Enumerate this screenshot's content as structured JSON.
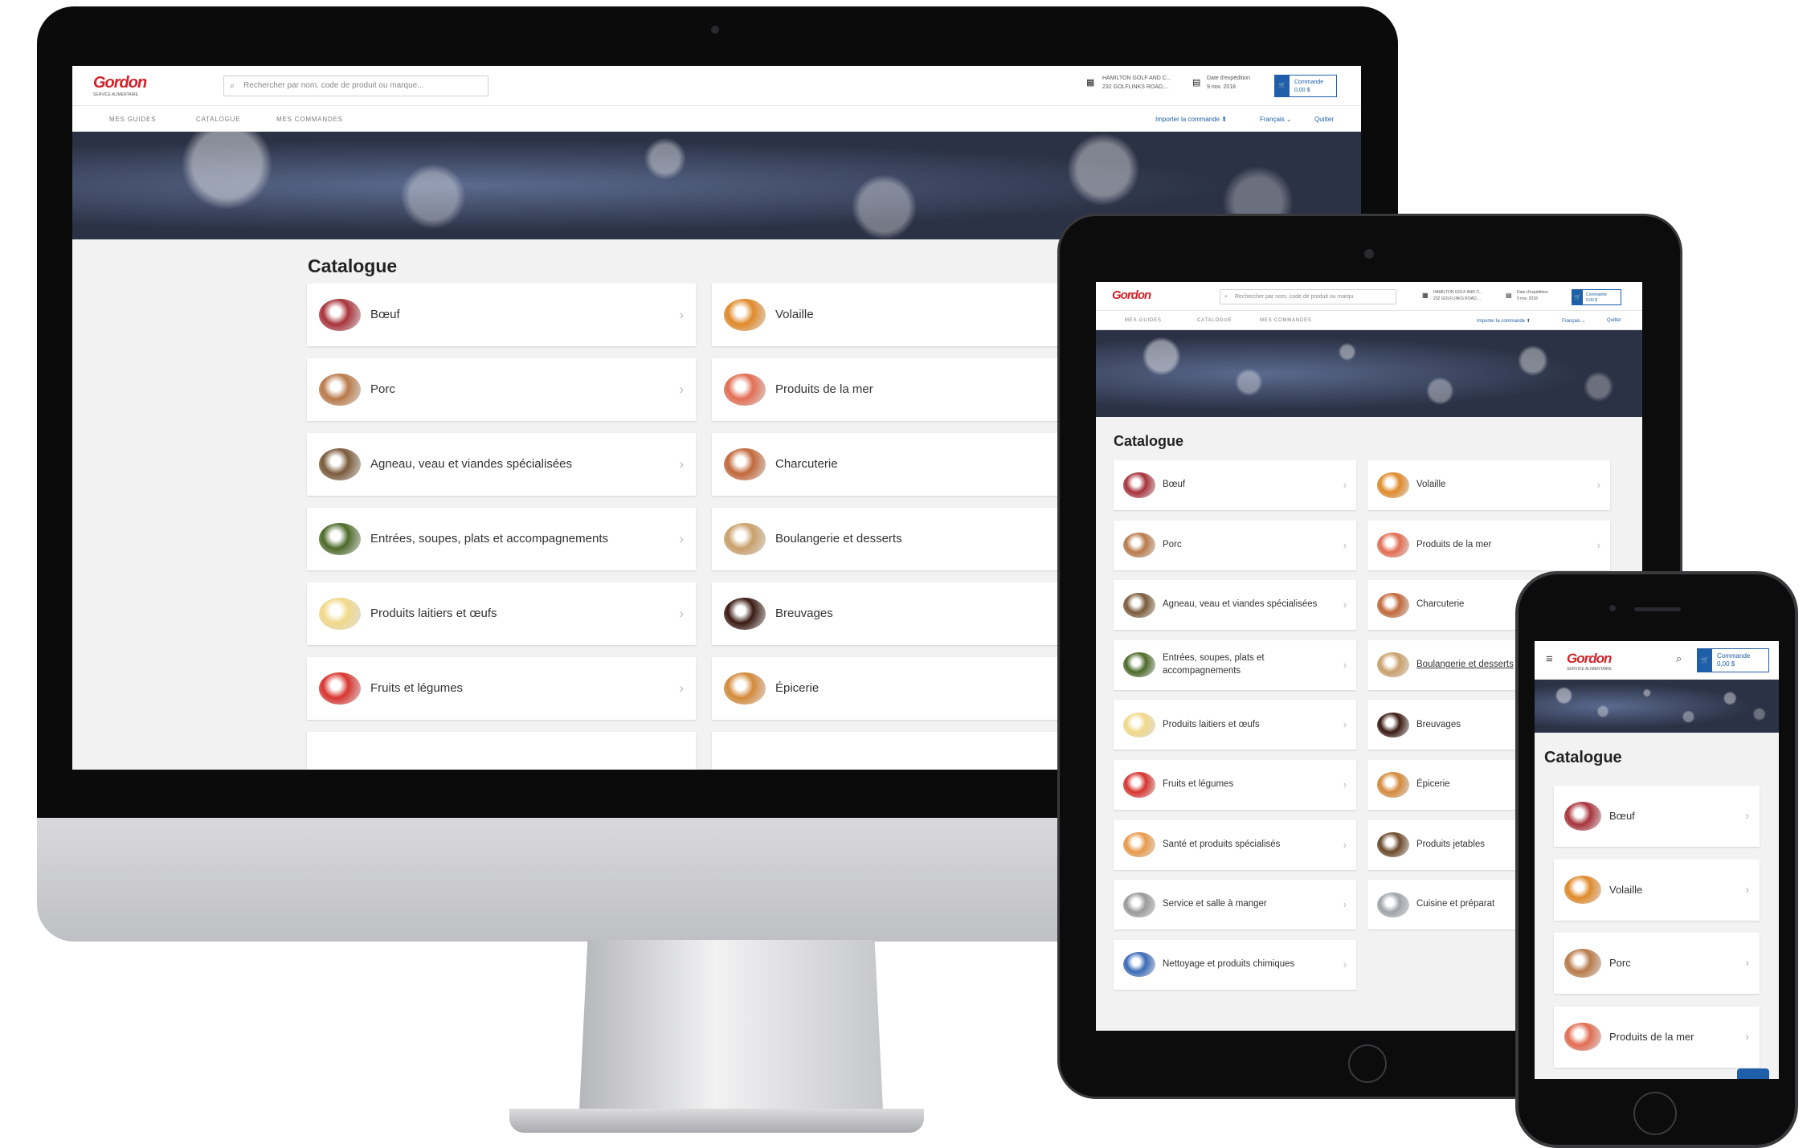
{
  "brand": {
    "name": "Gordon",
    "subtitle": "SERVICE ALIMENTAIRE",
    "color": "#d2232a",
    "accent": "#1f5ea8"
  },
  "header": {
    "search_placeholder": "Rechercher par nom, code de produit ou marque...",
    "tablet_search_placeholder": "Rechercher par nom, code de produit ou marqu",
    "location_line1": "HAMILTON GOLF AND C...",
    "location_line2": "232 GOLFLINKS ROAD,...",
    "date_label": "Date d'expédition",
    "date_value": "9 nov. 2018",
    "cart_label": "Commande",
    "cart_amount": "0,00 $",
    "cart_icon": "cart-icon",
    "location_icon": "store-icon",
    "calendar_icon": "calendar-icon"
  },
  "nav": {
    "items": [
      "MES GUIDES",
      "CATALOGUE",
      "MES COMMANDES"
    ],
    "import": "Importer la commande",
    "language": "Français",
    "quit": "Quitter"
  },
  "catalogue": {
    "title": "Catalogue",
    "desktop_left": [
      "Bœuf",
      "Porc",
      "Agneau, veau et viandes spécialisées",
      "Entrées, soupes, plats et accompagnements",
      "Produits laitiers et œufs",
      "Fruits et légumes"
    ],
    "desktop_right": [
      "Volaille",
      "Produits de la mer",
      "Charcuterie",
      "Boulangerie et desserts",
      "Breuvages",
      "Épicerie"
    ],
    "tablet_left": [
      "Bœuf",
      "Porc",
      "Agneau, veau et viandes spécialisées",
      "Entrées, soupes, plats et accompagnements",
      "Produits laitiers et œufs",
      "Fruits et légumes",
      "Santé et produits spécialisés",
      "Service et salle à manger",
      "Nettoyage et produits chimiques"
    ],
    "tablet_right": [
      "Volaille",
      "Produits de la mer",
      "Charcuterie",
      "Boulangerie et desserts",
      "Breuvages",
      "Épicerie",
      "Produits jetables",
      "Cuisine et préparat"
    ],
    "phone": [
      "Bœuf",
      "Volaille",
      "Porc",
      "Produits de la mer"
    ]
  },
  "icons": {
    "item_colors": {
      "Bœuf": "#a8333c",
      "Porc": "#b97a4a",
      "Agneau, veau et viandes spécialisées": "#7a5a3a",
      "Entrées, soupes, plats et accompagnements": "#4d6b2a",
      "Produits laitiers et œufs": "#f1d98a",
      "Fruits et légumes": "#d8352f",
      "Volaille": "#e08a2a",
      "Produits de la mer": "#e26d52",
      "Charcuterie": "#c2683a",
      "Boulangerie et desserts": "#c9a06a",
      "Breuvages": "#3a1a12",
      "Épicerie": "#d48a3a",
      "Santé et produits spécialisés": "#e89a4a",
      "Service et salle à manger": "#9a9a9a",
      "Nettoyage et produits chimiques": "#3a6bb8",
      "Produits jetables": "#6b4a2a",
      "Cuisine et préparat": "#a0a4aa"
    }
  }
}
